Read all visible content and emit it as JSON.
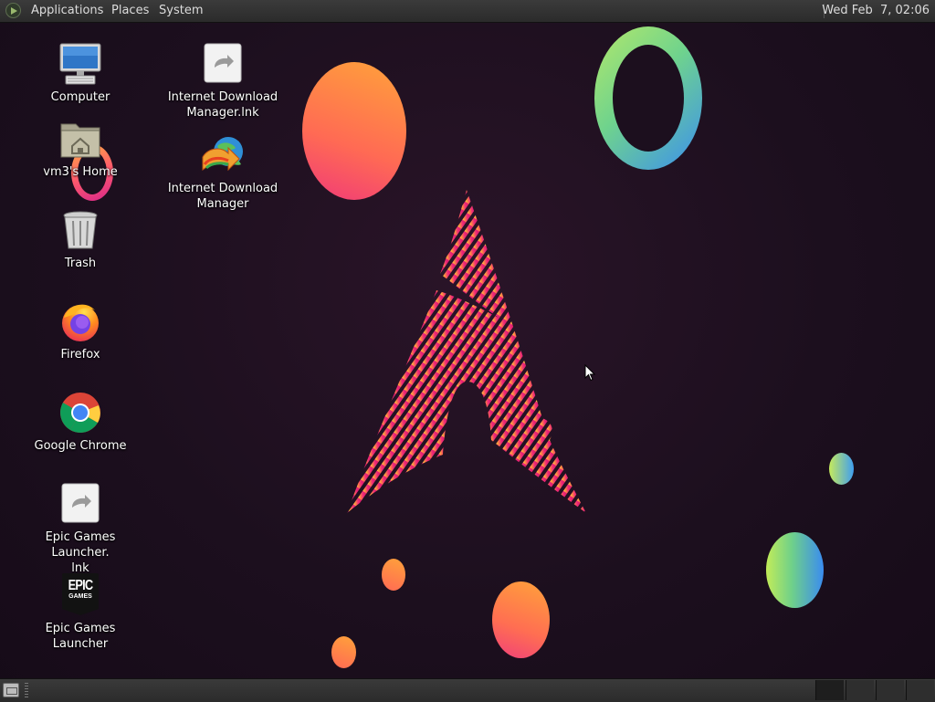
{
  "top_panel": {
    "menus": [
      "Applications",
      "Places",
      "System"
    ],
    "clock": "Wed Feb  7, 02:06"
  },
  "desktop_icons": [
    {
      "label": "Computer",
      "icon": "computer-icon"
    },
    {
      "label": "vm3's Home",
      "icon": "home-folder-icon"
    },
    {
      "label": "Trash",
      "icon": "trash-icon"
    },
    {
      "label": "Firefox",
      "icon": "firefox-icon"
    },
    {
      "label": "Google Chrome",
      "icon": "chrome-icon"
    },
    {
      "label": "Epic Games Launcher.\nlnk",
      "icon": "shortcut-icon"
    },
    {
      "label": "Epic Games Launcher",
      "icon": "epic-games-icon"
    },
    {
      "label": "Internet Download\nManager.lnk",
      "icon": "shortcut-icon"
    },
    {
      "label": "Internet Download\nManager",
      "icon": "idm-icon"
    }
  ],
  "epic_logo_text": [
    "EPIC",
    "GAMES"
  ],
  "colors": {
    "panel": "#2b2b2b",
    "wallpaper": "#1c0f1e",
    "accent_pink": "#e8206e",
    "accent_orange": "#ff9a3c"
  }
}
